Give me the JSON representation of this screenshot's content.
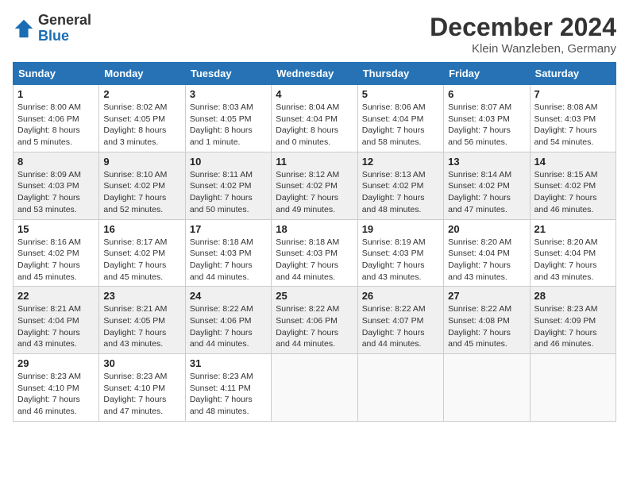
{
  "header": {
    "logo_general": "General",
    "logo_blue": "Blue",
    "month_title": "December 2024",
    "location": "Klein Wanzleben, Germany"
  },
  "weekdays": [
    "Sunday",
    "Monday",
    "Tuesday",
    "Wednesday",
    "Thursday",
    "Friday",
    "Saturday"
  ],
  "weeks": [
    [
      {
        "day": "1",
        "info": "Sunrise: 8:00 AM\nSunset: 4:06 PM\nDaylight: 8 hours\nand 5 minutes."
      },
      {
        "day": "2",
        "info": "Sunrise: 8:02 AM\nSunset: 4:05 PM\nDaylight: 8 hours\nand 3 minutes."
      },
      {
        "day": "3",
        "info": "Sunrise: 8:03 AM\nSunset: 4:05 PM\nDaylight: 8 hours\nand 1 minute."
      },
      {
        "day": "4",
        "info": "Sunrise: 8:04 AM\nSunset: 4:04 PM\nDaylight: 8 hours\nand 0 minutes."
      },
      {
        "day": "5",
        "info": "Sunrise: 8:06 AM\nSunset: 4:04 PM\nDaylight: 7 hours\nand 58 minutes."
      },
      {
        "day": "6",
        "info": "Sunrise: 8:07 AM\nSunset: 4:03 PM\nDaylight: 7 hours\nand 56 minutes."
      },
      {
        "day": "7",
        "info": "Sunrise: 8:08 AM\nSunset: 4:03 PM\nDaylight: 7 hours\nand 54 minutes."
      }
    ],
    [
      {
        "day": "8",
        "info": "Sunrise: 8:09 AM\nSunset: 4:03 PM\nDaylight: 7 hours\nand 53 minutes."
      },
      {
        "day": "9",
        "info": "Sunrise: 8:10 AM\nSunset: 4:02 PM\nDaylight: 7 hours\nand 52 minutes."
      },
      {
        "day": "10",
        "info": "Sunrise: 8:11 AM\nSunset: 4:02 PM\nDaylight: 7 hours\nand 50 minutes."
      },
      {
        "day": "11",
        "info": "Sunrise: 8:12 AM\nSunset: 4:02 PM\nDaylight: 7 hours\nand 49 minutes."
      },
      {
        "day": "12",
        "info": "Sunrise: 8:13 AM\nSunset: 4:02 PM\nDaylight: 7 hours\nand 48 minutes."
      },
      {
        "day": "13",
        "info": "Sunrise: 8:14 AM\nSunset: 4:02 PM\nDaylight: 7 hours\nand 47 minutes."
      },
      {
        "day": "14",
        "info": "Sunrise: 8:15 AM\nSunset: 4:02 PM\nDaylight: 7 hours\nand 46 minutes."
      }
    ],
    [
      {
        "day": "15",
        "info": "Sunrise: 8:16 AM\nSunset: 4:02 PM\nDaylight: 7 hours\nand 45 minutes."
      },
      {
        "day": "16",
        "info": "Sunrise: 8:17 AM\nSunset: 4:02 PM\nDaylight: 7 hours\nand 45 minutes."
      },
      {
        "day": "17",
        "info": "Sunrise: 8:18 AM\nSunset: 4:03 PM\nDaylight: 7 hours\nand 44 minutes."
      },
      {
        "day": "18",
        "info": "Sunrise: 8:18 AM\nSunset: 4:03 PM\nDaylight: 7 hours\nand 44 minutes."
      },
      {
        "day": "19",
        "info": "Sunrise: 8:19 AM\nSunset: 4:03 PM\nDaylight: 7 hours\nand 43 minutes."
      },
      {
        "day": "20",
        "info": "Sunrise: 8:20 AM\nSunset: 4:04 PM\nDaylight: 7 hours\nand 43 minutes."
      },
      {
        "day": "21",
        "info": "Sunrise: 8:20 AM\nSunset: 4:04 PM\nDaylight: 7 hours\nand 43 minutes."
      }
    ],
    [
      {
        "day": "22",
        "info": "Sunrise: 8:21 AM\nSunset: 4:04 PM\nDaylight: 7 hours\nand 43 minutes."
      },
      {
        "day": "23",
        "info": "Sunrise: 8:21 AM\nSunset: 4:05 PM\nDaylight: 7 hours\nand 43 minutes."
      },
      {
        "day": "24",
        "info": "Sunrise: 8:22 AM\nSunset: 4:06 PM\nDaylight: 7 hours\nand 44 minutes."
      },
      {
        "day": "25",
        "info": "Sunrise: 8:22 AM\nSunset: 4:06 PM\nDaylight: 7 hours\nand 44 minutes."
      },
      {
        "day": "26",
        "info": "Sunrise: 8:22 AM\nSunset: 4:07 PM\nDaylight: 7 hours\nand 44 minutes."
      },
      {
        "day": "27",
        "info": "Sunrise: 8:22 AM\nSunset: 4:08 PM\nDaylight: 7 hours\nand 45 minutes."
      },
      {
        "day": "28",
        "info": "Sunrise: 8:23 AM\nSunset: 4:09 PM\nDaylight: 7 hours\nand 46 minutes."
      }
    ],
    [
      {
        "day": "29",
        "info": "Sunrise: 8:23 AM\nSunset: 4:10 PM\nDaylight: 7 hours\nand 46 minutes."
      },
      {
        "day": "30",
        "info": "Sunrise: 8:23 AM\nSunset: 4:10 PM\nDaylight: 7 hours\nand 47 minutes."
      },
      {
        "day": "31",
        "info": "Sunrise: 8:23 AM\nSunset: 4:11 PM\nDaylight: 7 hours\nand 48 minutes."
      },
      {
        "day": "",
        "info": ""
      },
      {
        "day": "",
        "info": ""
      },
      {
        "day": "",
        "info": ""
      },
      {
        "day": "",
        "info": ""
      }
    ]
  ]
}
